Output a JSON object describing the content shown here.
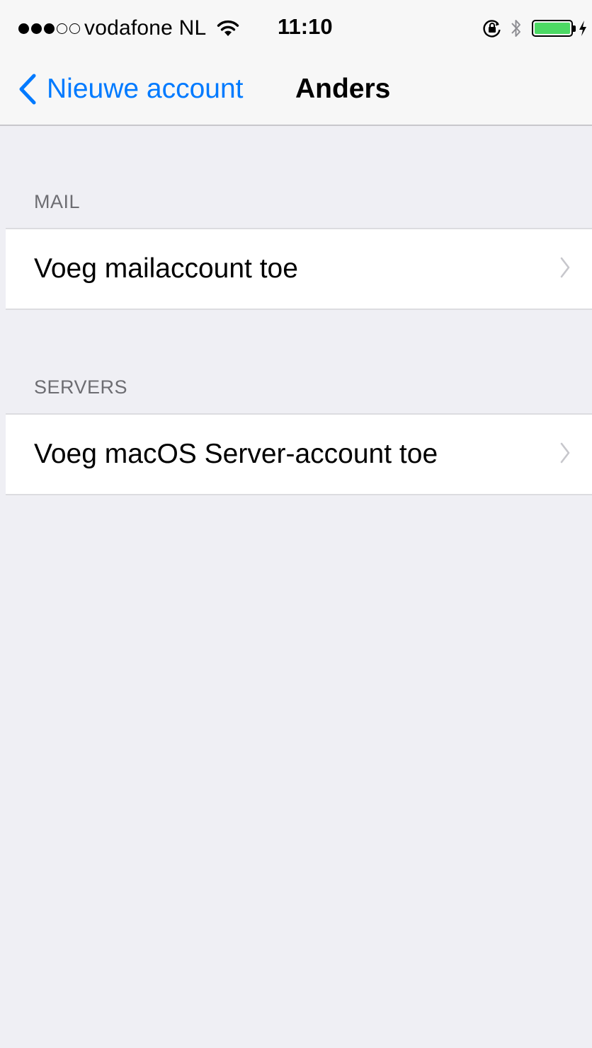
{
  "status_bar": {
    "signal_full": 3,
    "signal_total": 5,
    "carrier": "vodafone NL",
    "time": "11:10",
    "battery_level": 1.0,
    "battery_color": "#4cd964",
    "icons": [
      "wifi-icon",
      "orientation-lock-icon",
      "bluetooth-icon",
      "battery-icon",
      "charging-icon"
    ]
  },
  "nav": {
    "back_label": "Nieuwe account",
    "title": "Anders",
    "accent_color": "#007aff"
  },
  "sections": [
    {
      "header": "MAIL",
      "rows": [
        {
          "label": "Voeg mailaccount toe"
        }
      ]
    },
    {
      "header": "SERVERS",
      "rows": [
        {
          "label": "Voeg macOS Server-account toe"
        }
      ]
    }
  ]
}
